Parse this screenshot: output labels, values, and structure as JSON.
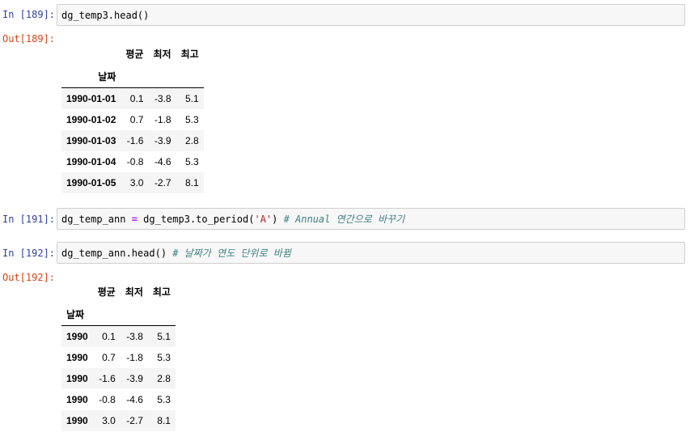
{
  "cells": [
    {
      "in_prompt": "In [189]:",
      "code": "dg_temp3.head()",
      "out_prompt": "Out[189]:",
      "table": {
        "columns": [
          "평균",
          "최저",
          "최고"
        ],
        "index_name": "날짜",
        "rows": [
          {
            "index": "1990-01-01",
            "values": [
              "0.1",
              "-3.8",
              "5.1"
            ]
          },
          {
            "index": "1990-01-02",
            "values": [
              "0.7",
              "-1.8",
              "5.3"
            ]
          },
          {
            "index": "1990-01-03",
            "values": [
              "-1.6",
              "-3.9",
              "2.8"
            ]
          },
          {
            "index": "1990-01-04",
            "values": [
              "-0.8",
              "-4.6",
              "5.3"
            ]
          },
          {
            "index": "1990-01-05",
            "values": [
              "3.0",
              "-2.7",
              "8.1"
            ]
          }
        ]
      }
    },
    {
      "in_prompt": "In [191]:",
      "code_parts": {
        "var": "dg_temp_ann ",
        "op": "=",
        "call": " dg_temp3.to_period(",
        "str": "'A'",
        "close": ") ",
        "comment": "# Annual 연간으로 바꾸기"
      }
    },
    {
      "in_prompt": "In [192]:",
      "code_parts": {
        "call": "dg_temp_ann.head() ",
        "comment": "# 날짜가 연도 단위로 바뀜"
      },
      "out_prompt": "Out[192]:",
      "table": {
        "columns": [
          "평균",
          "최저",
          "최고"
        ],
        "index_name": "날짜",
        "rows": [
          {
            "index": "1990",
            "values": [
              "0.1",
              "-3.8",
              "5.1"
            ]
          },
          {
            "index": "1990",
            "values": [
              "0.7",
              "-1.8",
              "5.3"
            ]
          },
          {
            "index": "1990",
            "values": [
              "-1.6",
              "-3.9",
              "2.8"
            ]
          },
          {
            "index": "1990",
            "values": [
              "-0.8",
              "-4.6",
              "5.3"
            ]
          },
          {
            "index": "1990",
            "values": [
              "3.0",
              "-2.7",
              "8.1"
            ]
          }
        ]
      }
    }
  ]
}
